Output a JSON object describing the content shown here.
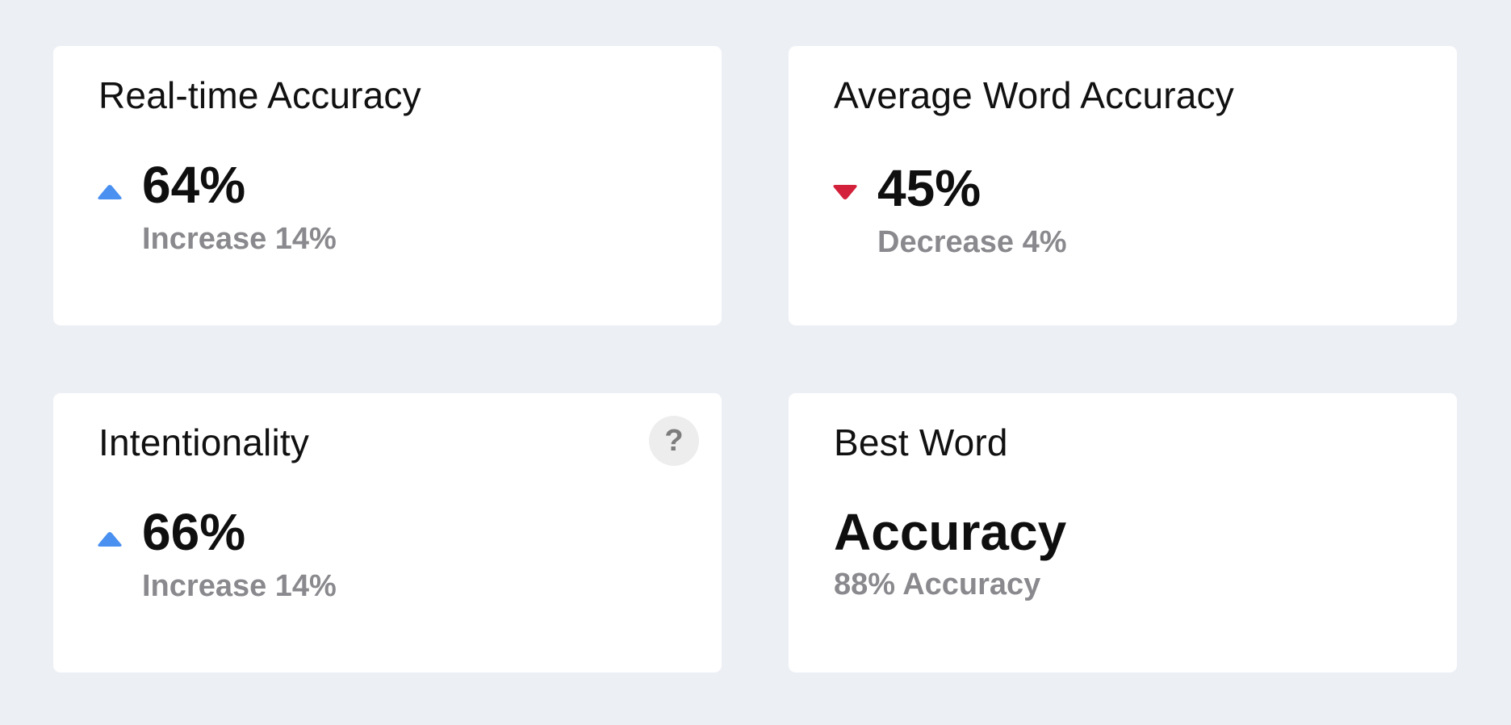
{
  "colors": {
    "background": "#eceff4",
    "card": "#ffffff",
    "increase": "#4a90f0",
    "decrease": "#d3203b",
    "muted_text": "#8a8a8e"
  },
  "cards": {
    "realtime_accuracy": {
      "title": "Real-time Accuracy",
      "value": "64%",
      "trend": "up",
      "trend_icon": "triangle-up-icon",
      "change_text": "Increase 14%"
    },
    "average_word_accuracy": {
      "title": "Average Word Accuracy",
      "value": "45%",
      "trend": "down",
      "trend_icon": "triangle-down-icon",
      "change_text": "Decrease 4%"
    },
    "intentionality": {
      "title": "Intentionality",
      "value": "66%",
      "trend": "up",
      "trend_icon": "triangle-up-icon",
      "change_text": "Increase 14%",
      "help_label": "?",
      "help_icon": "question-mark-icon"
    },
    "best_word": {
      "title": "Best Word",
      "word": "Accuracy",
      "detail": "88% Accuracy"
    }
  }
}
